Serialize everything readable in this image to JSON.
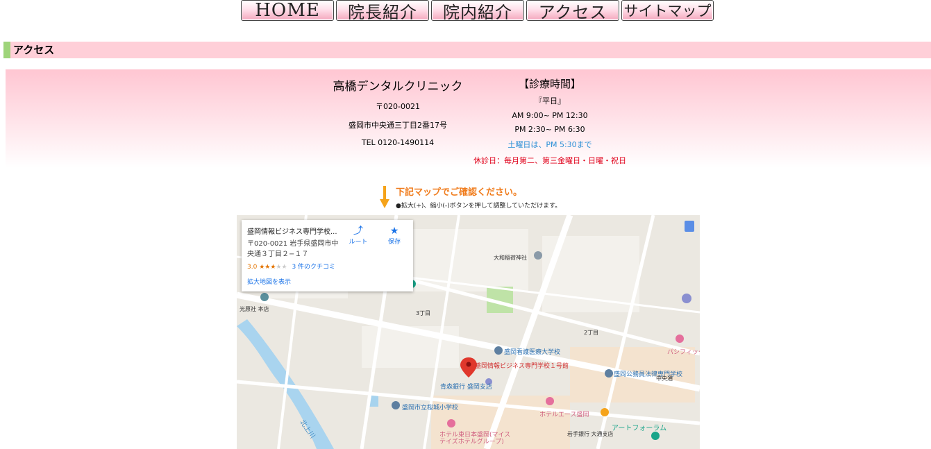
{
  "nav": {
    "home": "HOME",
    "director": "院長紹介",
    "interior": "院内紹介",
    "access": "アクセス",
    "sitemap": "サイトマップ"
  },
  "section": {
    "title": "アクセス"
  },
  "clinic": {
    "name": "高橋デンタルクリニック",
    "postal": "〒020-0021",
    "address": "盛岡市中央通三丁目2番17号",
    "tel": "TEL 0120-1490114"
  },
  "hours": {
    "title": "【診療時間】",
    "weekday_label": "『平日』",
    "am": "AM 9:00~ PM 12:30",
    "pm": "PM 2:30~ PM 6:30",
    "saturday": "土曜日は、PM 5:30まで",
    "closed": "休診日：毎月第二、第三金曜日・日曜・祝日"
  },
  "map_note": {
    "title": "下記マップでご確認ください。",
    "subtitle": "●拡大(+)、縮小(-)ボタンを押して調整していただけます。"
  },
  "map": {
    "card": {
      "title": "盛岡情報ビジネス専門学校...",
      "address": "〒020-0021 岩手県盛岡市中央通３丁目２−１７",
      "rating": "3.0",
      "stars": "★★★",
      "stars_empty": "★★",
      "reviews": "3 件のクチコミ",
      "route": "ルート",
      "save": "保存",
      "larger_map": "拡大地図を表示"
    },
    "labels": {
      "marker": "盛岡情報ビジネス専門学校１号館",
      "nursing": "盛岡看護医療大学校",
      "koumuin": "盛岡公務員法律専門学校",
      "sakurajo": "盛岡市立桜城小学校",
      "aomori": "青森銀行 盛岡支店",
      "hotel_ace": "ホテルエース盛岡",
      "hotel_higashi": "ホテル東日本盛岡(マイステイズホテルグループ)",
      "art_forum": "アートフォーラム",
      "iwate_bank": "岩手銀行 大通支店",
      "kitakami": "北上川",
      "daiwa": "大和稲荷神社",
      "chuodori": "中央通",
      "sanchome": "3丁目",
      "nichome": "2丁目",
      "hikari": "光原社 本店",
      "pashifikku": "パシフィック"
    }
  }
}
